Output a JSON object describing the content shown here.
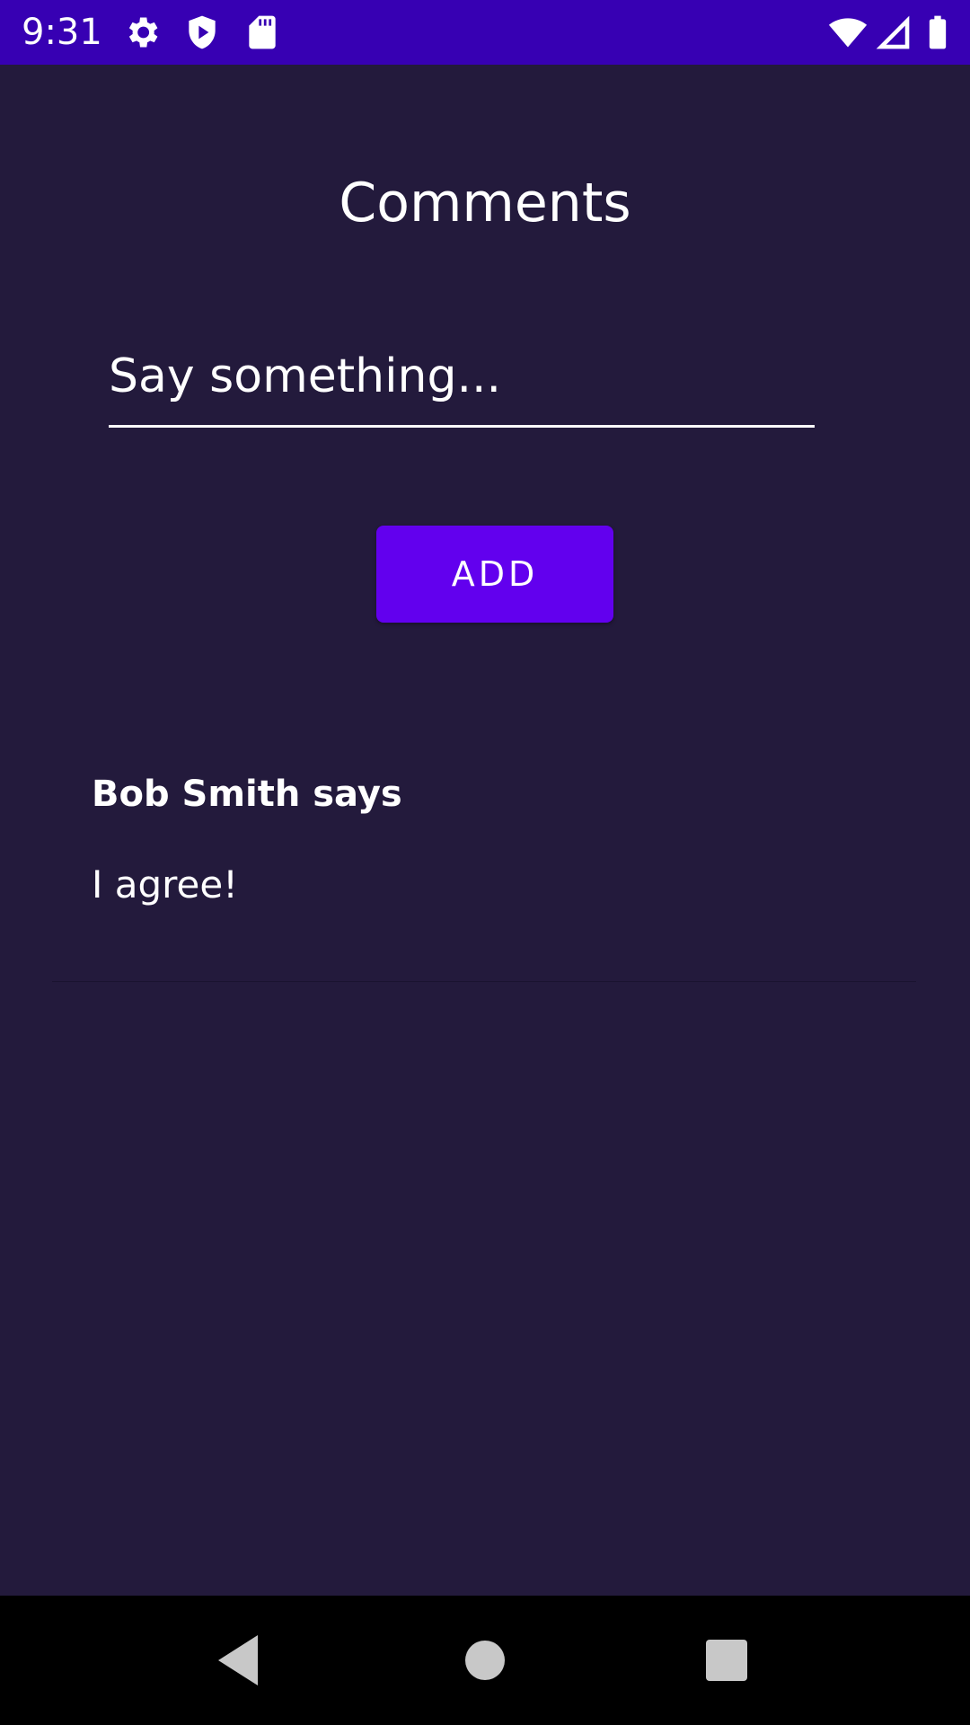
{
  "status_bar": {
    "time": "9:31",
    "icons": [
      "gear-icon",
      "shield-play-icon",
      "sd-card-icon",
      "wifi-icon",
      "cell-signal-icon",
      "battery-icon"
    ],
    "background_color": "#3700b3"
  },
  "page": {
    "title": "Comments",
    "background_color": "#231a3c"
  },
  "comment_form": {
    "placeholder": "Say something...",
    "value": "",
    "add_label": "ADD",
    "button_color": "#6200ee"
  },
  "comments": [
    {
      "author": "Bob Smith says",
      "text": "I agree!"
    }
  ],
  "nav_bar": {
    "buttons": [
      "back-icon",
      "home-icon",
      "recents-icon"
    ]
  }
}
